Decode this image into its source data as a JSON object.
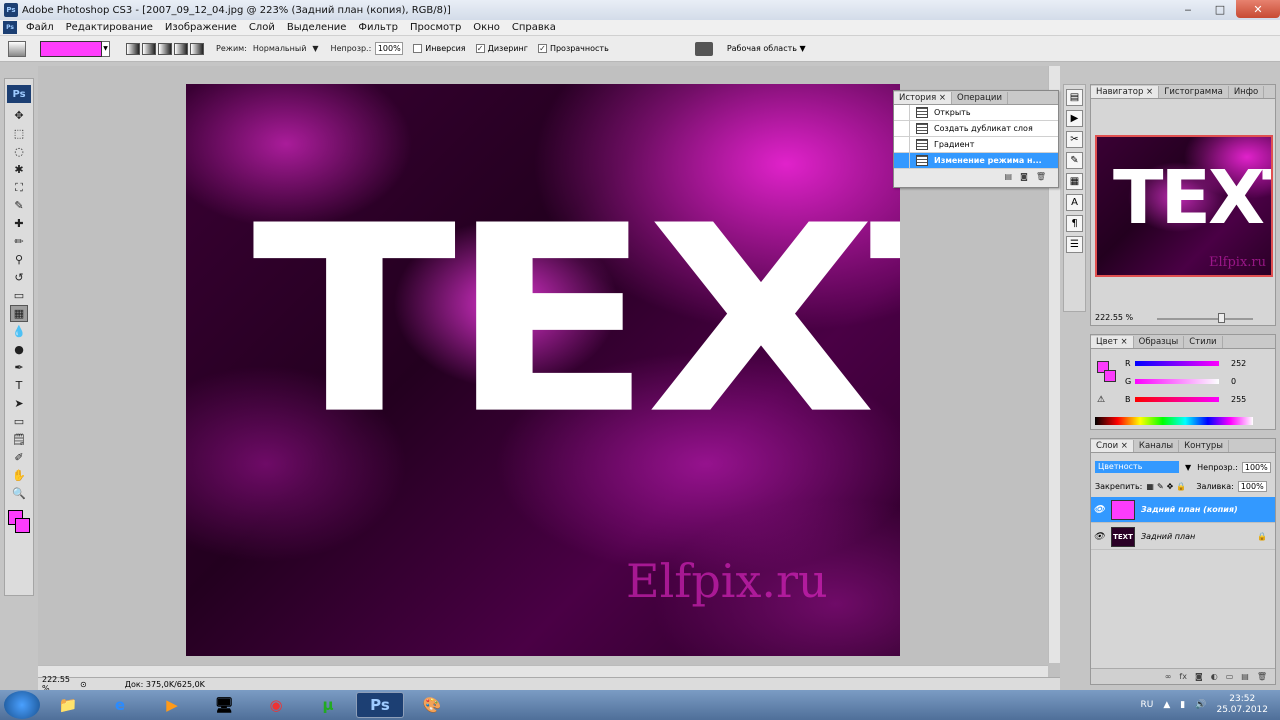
{
  "window": {
    "title": "Adobe Photoshop CS3 - [2007_09_12_04.jpg @ 223% (Задний план (копия), RGB/8)]",
    "minimize": "‒",
    "maximize": "□",
    "close": "✕"
  },
  "app_logo": "Ps",
  "menu": [
    "Файл",
    "Редактирование",
    "Изображение",
    "Слой",
    "Выделение",
    "Фильтр",
    "Просмотр",
    "Окно",
    "Справка"
  ],
  "options": {
    "mode_label": "Режим:",
    "mode_value": "Нормальный",
    "opacity_label": "Непрозр.:",
    "opacity_value": "100%",
    "invert_label": "Инверсия",
    "invert_checked": "",
    "dither_label": "Дизеринг",
    "dither_checked": "✓",
    "transparency_label": "Прозрачность",
    "transparency_checked": "✓",
    "workspace_label": "Рабочая область ▼",
    "gradient_color": "#ff3dfc"
  },
  "tools": [
    "move-icon",
    "marquee-icon",
    "lasso-icon",
    "magic-wand-icon",
    "crop-icon",
    "eyedropper-icon",
    "healing-brush-icon",
    "brush-icon",
    "clone-stamp-icon",
    "history-brush-icon",
    "eraser-icon",
    "gradient-icon",
    "blur-icon",
    "dodge-icon",
    "pen-icon",
    "type-icon",
    "path-selection-icon",
    "shape-icon",
    "notes-icon",
    "eyedropper2-icon",
    "hand-icon",
    "zoom-icon"
  ],
  "tool_glyphs": [
    "✥",
    "⬚",
    "◌",
    "✱",
    "⛶",
    "✎",
    "✚",
    "✏",
    "⚲",
    "↺",
    "▭",
    "▦",
    "💧",
    "●",
    "✒",
    "T",
    "➤",
    "▭",
    "🗒",
    "✐",
    "✋",
    "🔍"
  ],
  "canvas": {
    "text": "TEXT",
    "watermark": "Elfpix.ru"
  },
  "status": {
    "zoom": "222.55 %",
    "doc": "Док: 375,0K/625,0K"
  },
  "history_panel": {
    "tabs": [
      "История ×",
      "Операции"
    ],
    "items": [
      "Открыть",
      "Создать дубликат слоя",
      "Градиент",
      "Изменение режима н..."
    ],
    "selected_index": 3
  },
  "navigator_panel": {
    "tabs": [
      "Навигатор ×",
      "Гистограмма",
      "Инфо"
    ],
    "zoom": "222.55 %",
    "thumb_text": "TEXT",
    "thumb_watermark": "Elfpix.ru"
  },
  "color_panel": {
    "tabs": [
      "Цвет ×",
      "Образцы",
      "Стили"
    ],
    "r_label": "R",
    "r_value": "252",
    "g_label": "G",
    "g_value": "0",
    "b_label": "B",
    "b_value": "255",
    "warning": "⚠"
  },
  "layers_panel": {
    "tabs": [
      "Слои ×",
      "Каналы",
      "Контуры"
    ],
    "blend_mode": "Цветность",
    "opacity_label": "Непрозр.:",
    "opacity_value": "100%",
    "lock_label": "Закрепить:",
    "fill_label": "Заливка:",
    "fill_value": "100%",
    "layers": [
      {
        "name": "Задний план (копия)",
        "selected": true,
        "thumb_color": "#fc3cfc"
      },
      {
        "name": "Задний план",
        "selected": false,
        "thumb_text": "TEXT",
        "lock": "🔒"
      }
    ]
  },
  "taskbar": {
    "apps": [
      "folder-icon",
      "ie-icon",
      "media-player-icon",
      "computer-icon",
      "chrome-icon",
      "utorrent-icon",
      "photoshop-icon",
      "paint-icon"
    ],
    "ps_label": "Ps",
    "lang": "RU",
    "time": "23:52",
    "date": "25.07.2012"
  }
}
